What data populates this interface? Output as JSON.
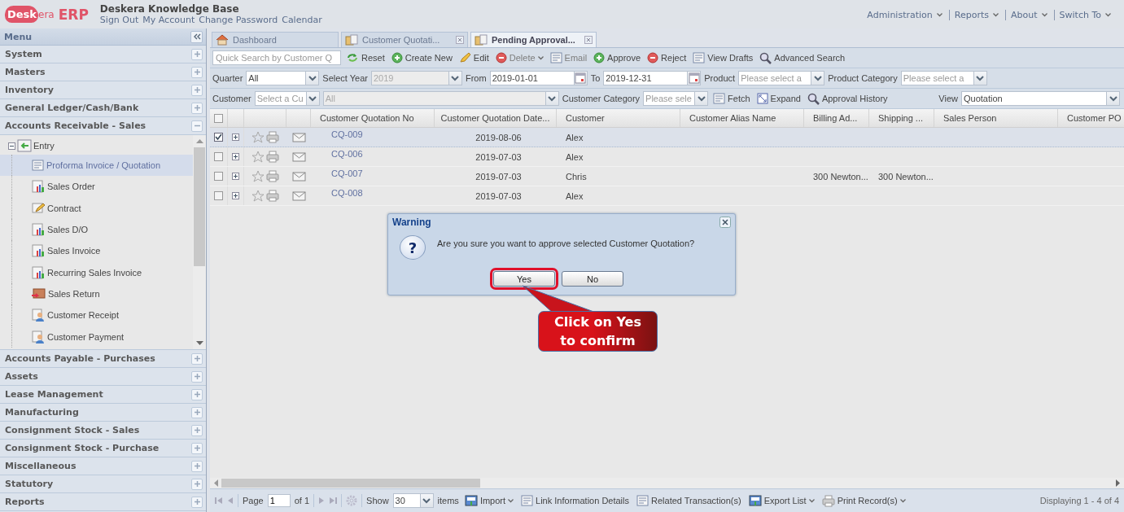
{
  "header": {
    "logo": {
      "badge": "Desk",
      "rest": "era",
      "suffix": "ERP"
    },
    "title": "Deskera Knowledge Base",
    "links": [
      "Sign Out",
      "My Account",
      "Change Password",
      "Calendar"
    ],
    "menus": [
      {
        "label": "Administration",
        "has_menu": true
      },
      {
        "label": "Reports",
        "has_menu": true
      },
      {
        "label": "About",
        "has_menu": true
      },
      {
        "label": "Switch To",
        "has_menu": true
      }
    ]
  },
  "sidebar": {
    "title": "Menu",
    "sections": [
      {
        "label": "System",
        "expanded": false
      },
      {
        "label": "Masters",
        "expanded": false
      },
      {
        "label": "Inventory",
        "expanded": false
      },
      {
        "label": "General Ledger/Cash/Bank",
        "expanded": false
      },
      {
        "label": "Accounts Receivable - Sales",
        "expanded": true,
        "tree": [
          {
            "label": "Entry",
            "expanded": true,
            "children": [
              {
                "label": "Proforma Invoice / Quotation",
                "selected": true
              },
              {
                "label": "Sales Order",
                "selected": false
              },
              {
                "label": "Contract",
                "selected": false
              },
              {
                "label": "Sales D/O",
                "selected": false
              },
              {
                "label": "Sales Invoice",
                "selected": false
              },
              {
                "label": "Recurring Sales Invoice",
                "selected": false
              },
              {
                "label": "Sales Return",
                "selected": false
              },
              {
                "label": "Customer Receipt",
                "selected": false
              },
              {
                "label": "Customer Payment",
                "selected": false
              }
            ]
          }
        ]
      },
      {
        "label": "Accounts Payable - Purchases",
        "expanded": false
      },
      {
        "label": "Assets",
        "expanded": false
      },
      {
        "label": "Lease Management",
        "expanded": false
      },
      {
        "label": "Manufacturing",
        "expanded": false
      },
      {
        "label": "Consignment Stock - Sales",
        "expanded": false
      },
      {
        "label": "Consignment Stock - Purchase",
        "expanded": false
      },
      {
        "label": "Miscellaneous",
        "expanded": false
      },
      {
        "label": "Statutory",
        "expanded": false
      },
      {
        "label": "Reports",
        "expanded": false
      }
    ]
  },
  "tabs": [
    {
      "label": "Dashboard",
      "selected": false,
      "closable": false
    },
    {
      "label": "Customer Quotati...",
      "selected": false,
      "closable": true
    },
    {
      "label": "Pending Approval...",
      "selected": true,
      "closable": true
    }
  ],
  "toolbar": {
    "search_placeholder": "Quick Search by Customer Q",
    "buttons": [
      {
        "label": "Reset",
        "disabled": false,
        "has_menu": false
      },
      {
        "label": "Create New",
        "disabled": false,
        "has_menu": false
      },
      {
        "label": "Edit",
        "disabled": false,
        "has_menu": false
      },
      {
        "label": "Delete",
        "disabled": true,
        "has_menu": true
      },
      {
        "label": "Email",
        "disabled": true,
        "has_menu": false
      },
      {
        "label": "Approve",
        "disabled": false,
        "has_menu": false
      },
      {
        "label": "Reject",
        "disabled": false,
        "has_menu": false
      },
      {
        "label": "View Drafts",
        "disabled": false,
        "has_menu": false
      },
      {
        "label": "Advanced Search",
        "disabled": false,
        "has_menu": false
      }
    ]
  },
  "filter_rows": [
    {
      "items": [
        {
          "kind": "label",
          "text": "Quarter"
        },
        {
          "kind": "combo",
          "value": "All",
          "disabled": false
        },
        {
          "kind": "label",
          "text": "Select Year"
        },
        {
          "kind": "combo",
          "value": "2019",
          "disabled": true
        },
        {
          "kind": "label",
          "text": "From"
        },
        {
          "kind": "date",
          "value": "2019-01-01"
        },
        {
          "kind": "label",
          "text": "To"
        },
        {
          "kind": "date",
          "value": "2019-12-31"
        },
        {
          "kind": "label",
          "text": "Product"
        },
        {
          "kind": "combo",
          "placeholder": "Please select a",
          "disabled": false
        },
        {
          "kind": "label",
          "text": "Product Category"
        },
        {
          "kind": "combo",
          "placeholder": "Please select a",
          "disabled": false
        }
      ]
    },
    {
      "items": [
        {
          "kind": "label",
          "text": "Customer"
        },
        {
          "kind": "combo",
          "placeholder": "Select a Cu",
          "disabled": false
        },
        {
          "kind": "combo",
          "value": "All",
          "disabled": true
        },
        {
          "kind": "label",
          "text": "Customer Category"
        },
        {
          "kind": "combo",
          "placeholder": "Please sele",
          "disabled": false
        },
        {
          "kind": "button",
          "text": "Fetch"
        },
        {
          "kind": "button",
          "text": "Expand"
        },
        {
          "kind": "button",
          "text": "Approval History"
        }
      ],
      "right_items": [
        {
          "kind": "label",
          "text": "View"
        },
        {
          "kind": "combo",
          "value": "Quotation",
          "disabled": false
        }
      ]
    }
  ],
  "grid": {
    "all_checked": false,
    "columns": [
      "Customer Quotation No",
      "Customer Quotation Date...",
      "Customer",
      "Customer Alias Name",
      "Billing Ad...",
      "Shipping ...",
      "Sales Person",
      "Customer PO"
    ],
    "rows": [
      {
        "checked": true,
        "cells": {
          "quotation_no": "CQ-009",
          "date": "2019-08-06",
          "customer": "Alex"
        }
      },
      {
        "checked": false,
        "cells": {
          "quotation_no": "CQ-006",
          "date": "2019-07-03",
          "customer": "Alex"
        }
      },
      {
        "checked": false,
        "cells": {
          "quotation_no": "CQ-007",
          "date": "2019-07-03",
          "customer": "Chris",
          "billing_address": "300 Newton...",
          "shipping_address": "300 Newton..."
        }
      },
      {
        "checked": false,
        "cells": {
          "quotation_no": "CQ-008",
          "date": "2019-07-03",
          "customer": "Alex"
        }
      }
    ]
  },
  "pager": {
    "page_label": "Page",
    "page": "1",
    "of": "of 1",
    "show_label": "Show",
    "page_size": "30",
    "items_label": "items",
    "actions": [
      {
        "label": "Import",
        "has_menu": true
      },
      {
        "label": "Link Information Details",
        "has_menu": false
      },
      {
        "label": "Related Transaction(s)",
        "has_menu": false
      },
      {
        "label": "Export List",
        "has_menu": true
      },
      {
        "label": "Print Record(s)",
        "has_menu": true
      }
    ],
    "display": "Displaying 1 - 4 of 4"
  },
  "dialog": {
    "title": "Warning",
    "icon_glyph": "?",
    "message": "Are you sure you want to approve selected Customer Quotation?",
    "buttons": [
      {
        "label": "Yes",
        "highlighted": true
      },
      {
        "label": "No",
        "highlighted": false
      }
    ]
  },
  "callout": {
    "text": "Click on Yes to confirm"
  }
}
